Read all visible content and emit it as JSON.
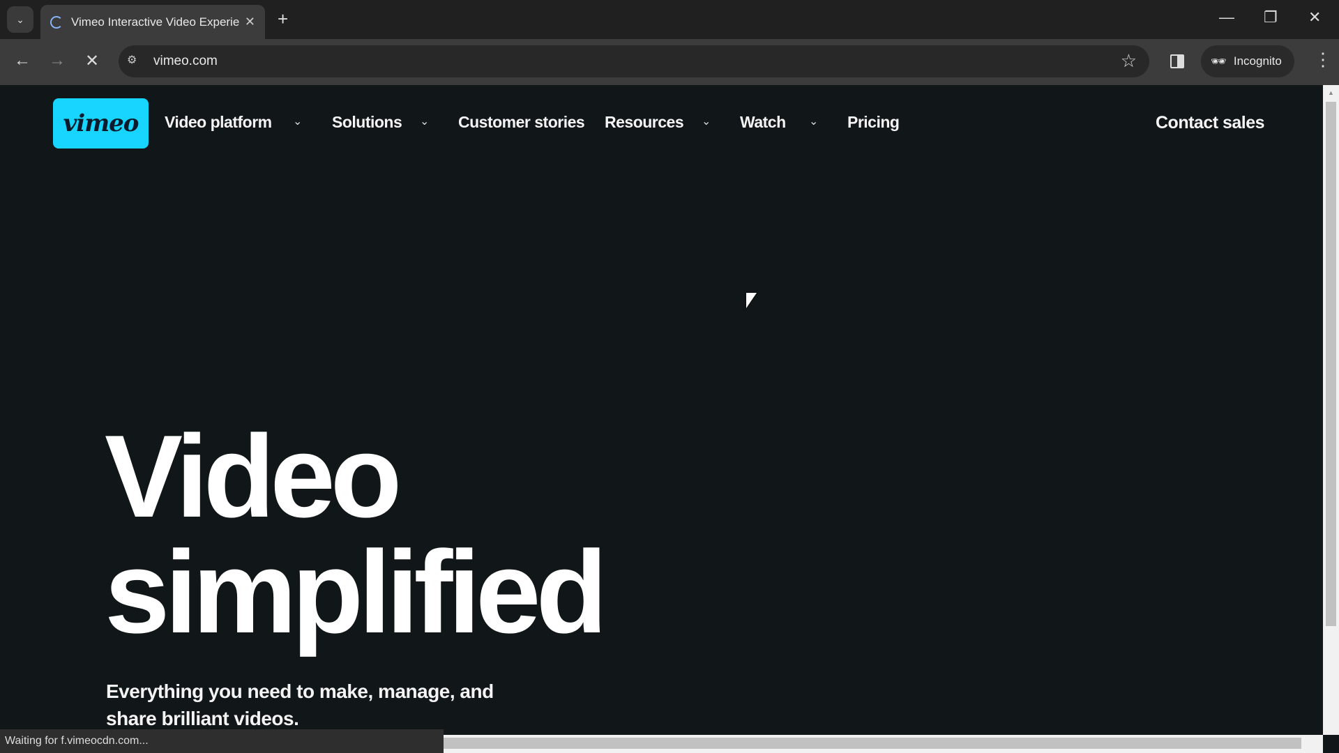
{
  "browser": {
    "tab_title": "Vimeo Interactive Video Experie",
    "url": "vimeo.com",
    "profile": "Incognito",
    "status": "Waiting for f.vimeocdn.com..."
  },
  "nav": {
    "logo": "vimeo",
    "items": [
      {
        "label": "Video platform",
        "dropdown": true
      },
      {
        "label": "Solutions",
        "dropdown": true
      },
      {
        "label": "Customer stories",
        "dropdown": false
      },
      {
        "label": "Resources",
        "dropdown": true
      },
      {
        "label": "Watch",
        "dropdown": true
      },
      {
        "label": "Pricing",
        "dropdown": false
      }
    ],
    "contact": "Contact sales"
  },
  "hero": {
    "line1": "Video",
    "line2": "simplified",
    "subtitle": "Everything you need to make, manage, and share brilliant videos."
  },
  "colors": {
    "brand": "#17d5ff",
    "background": "#111618"
  }
}
